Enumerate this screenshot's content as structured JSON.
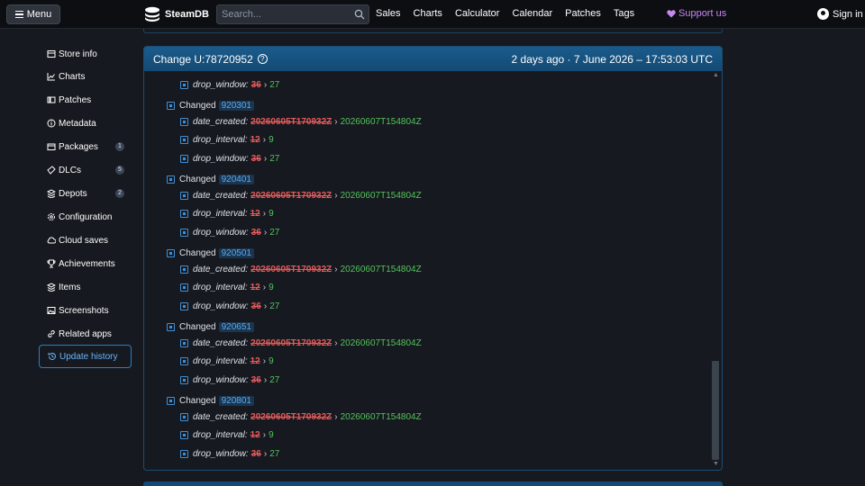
{
  "header": {
    "menu_label": "Menu",
    "logo_text": "SteamDB",
    "search_placeholder": "Search...",
    "nav": [
      "Sales",
      "Charts",
      "Calculator",
      "Calendar",
      "Patches",
      "Tags"
    ],
    "support_label": "Support us",
    "signin_label": "Sign in"
  },
  "sidebar": {
    "items": [
      {
        "label": "Store info",
        "icon": "store-icon"
      },
      {
        "label": "Charts",
        "icon": "chart-icon"
      },
      {
        "label": "Patches",
        "icon": "patches-icon"
      },
      {
        "label": "Metadata",
        "icon": "info-icon"
      },
      {
        "label": "Packages",
        "icon": "package-icon",
        "badge": "1"
      },
      {
        "label": "DLCs",
        "icon": "dlc-icon",
        "badge": "5"
      },
      {
        "label": "Depots",
        "icon": "depots-icon",
        "badge": "2"
      },
      {
        "label": "Configuration",
        "icon": "gear-icon"
      },
      {
        "label": "Cloud saves",
        "icon": "cloud-icon"
      },
      {
        "label": "Achievements",
        "icon": "trophy-icon"
      },
      {
        "label": "Items",
        "icon": "items-icon"
      },
      {
        "label": "Screenshots",
        "icon": "image-icon"
      },
      {
        "label": "Related apps",
        "icon": "link-icon"
      },
      {
        "label": "Update history",
        "icon": "history-icon",
        "active": true
      }
    ]
  },
  "panel": {
    "title": "Change U:78720952",
    "when": "2 days ago · 7 June 2026 – 17:53:03 UTC",
    "first_row": {
      "key": "drop_window:",
      "old": "36",
      "new": "27"
    },
    "changed_label": "Changed",
    "groups": [
      {
        "id": "920301",
        "fields": [
          {
            "key": "date_created:",
            "old": "20260605T170932Z",
            "new": "20260607T154804Z"
          },
          {
            "key": "drop_interval:",
            "old": "12",
            "new": "9"
          },
          {
            "key": "drop_window:",
            "old": "36",
            "new": "27"
          }
        ]
      },
      {
        "id": "920401",
        "fields": [
          {
            "key": "date_created:",
            "old": "20260605T170932Z",
            "new": "20260607T154804Z"
          },
          {
            "key": "drop_interval:",
            "old": "12",
            "new": "9"
          },
          {
            "key": "drop_window:",
            "old": "36",
            "new": "27"
          }
        ]
      },
      {
        "id": "920501",
        "fields": [
          {
            "key": "date_created:",
            "old": "20260605T170932Z",
            "new": "20260607T154804Z"
          },
          {
            "key": "drop_interval:",
            "old": "12",
            "new": "9"
          },
          {
            "key": "drop_window:",
            "old": "36",
            "new": "27"
          }
        ]
      },
      {
        "id": "920651",
        "fields": [
          {
            "key": "date_created:",
            "old": "20260605T170932Z",
            "new": "20260607T154804Z"
          },
          {
            "key": "drop_interval:",
            "old": "12",
            "new": "9"
          },
          {
            "key": "drop_window:",
            "old": "36",
            "new": "27"
          }
        ]
      },
      {
        "id": "920801",
        "fields": [
          {
            "key": "date_created:",
            "old": "20260605T170932Z",
            "new": "20260607T154804Z"
          },
          {
            "key": "drop_interval:",
            "old": "12",
            "new": "9"
          },
          {
            "key": "drop_window:",
            "old": "36",
            "new": "27"
          }
        ]
      }
    ]
  },
  "colors": {
    "accent": "#1a5b8c",
    "old": "#e45b5b",
    "new": "#55c25c",
    "support": "#c788f0"
  }
}
